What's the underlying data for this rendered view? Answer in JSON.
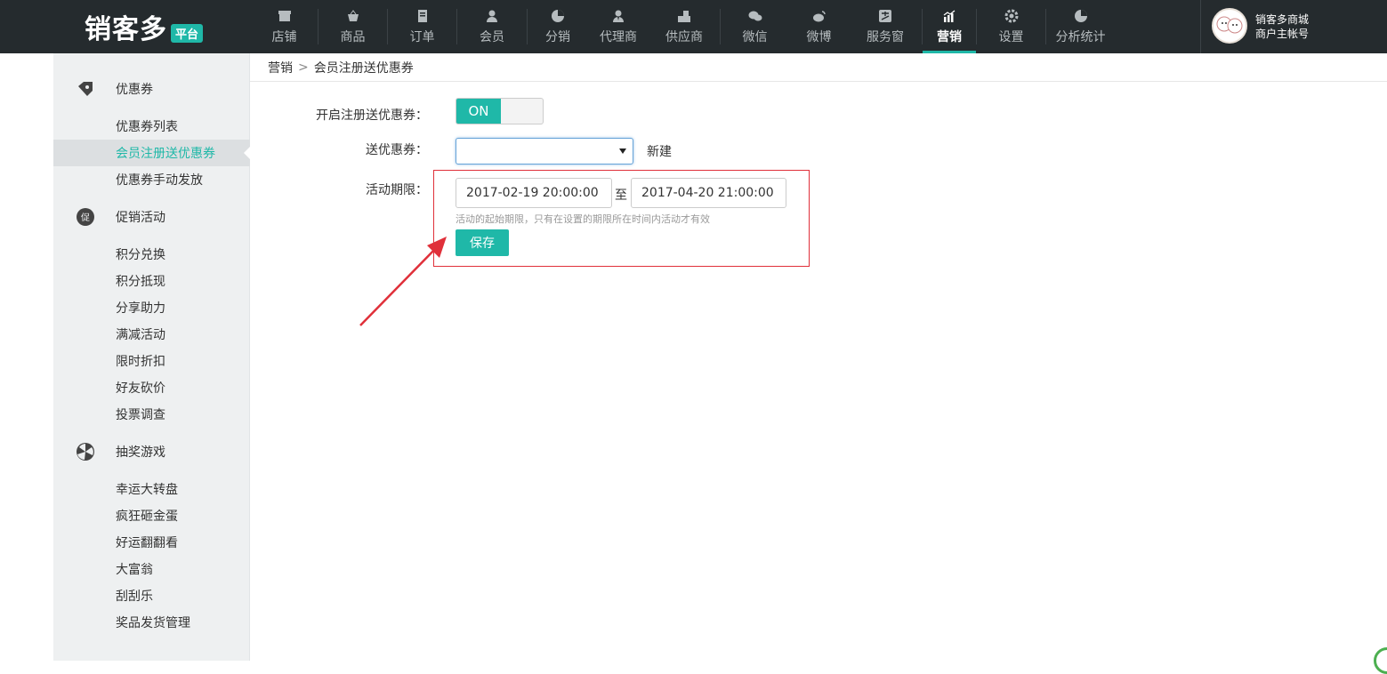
{
  "brand": {
    "name": "销客多",
    "badge": "平台"
  },
  "nav": [
    {
      "label": "店铺",
      "icon": "store-icon"
    },
    {
      "label": "商品",
      "icon": "basket-icon"
    },
    {
      "label": "订单",
      "icon": "order-icon"
    },
    {
      "label": "会员",
      "icon": "member-icon"
    },
    {
      "label": "分销",
      "icon": "pie-icon"
    },
    {
      "label": "代理商",
      "icon": "agent-icon"
    },
    {
      "label": "供应商",
      "icon": "supplier-icon"
    },
    {
      "label": "微信",
      "icon": "wechat-icon"
    },
    {
      "label": "微博",
      "icon": "weibo-icon"
    },
    {
      "label": "服务窗",
      "icon": "alipay-icon"
    },
    {
      "label": "营销",
      "icon": "chart-icon",
      "active": true
    },
    {
      "label": "设置",
      "icon": "gear-icon"
    },
    {
      "label": "分析统计",
      "icon": "stats-icon"
    }
  ],
  "user": {
    "name": "销客多商城",
    "role": "商户主帐号"
  },
  "sidebar": {
    "groups": [
      {
        "label": "优惠券",
        "icon": "coupon-icon",
        "items": [
          "优惠券列表",
          "会员注册送优惠券",
          "优惠券手动发放"
        ]
      },
      {
        "label": "促销活动",
        "icon": "promo-icon",
        "items": [
          "积分兑换",
          "积分抵现",
          "分享助力",
          "满减活动",
          "限时折扣",
          "好友砍价",
          "投票调查"
        ]
      },
      {
        "label": "抽奖游戏",
        "icon": "lottery-icon",
        "items": [
          "幸运大转盘",
          "疯狂砸金蛋",
          "好运翻翻看",
          "大富翁",
          "刮刮乐",
          "奖品发货管理"
        ]
      }
    ],
    "active_item": "会员注册送优惠券"
  },
  "breadcrumb": {
    "parent": "营销",
    "sep": ">",
    "current": "会员注册送优惠券"
  },
  "form": {
    "enable_label": "开启注册送优惠券：",
    "toggle_state": "ON",
    "coupon_label": "送优惠券：",
    "coupon_value": "",
    "new_link": "新建",
    "period_label": "活动期限：",
    "start": "2017-02-19 20:00:00",
    "to": "至",
    "end": "2017-04-20 21:00:00",
    "hint": "活动的起始期限，只有在设置的期限所在时间内活动才有效",
    "save_label": "保存"
  },
  "colors": {
    "accent": "#1fb8a8",
    "topbar": "#252b2e",
    "annotation": "#e0303a"
  }
}
